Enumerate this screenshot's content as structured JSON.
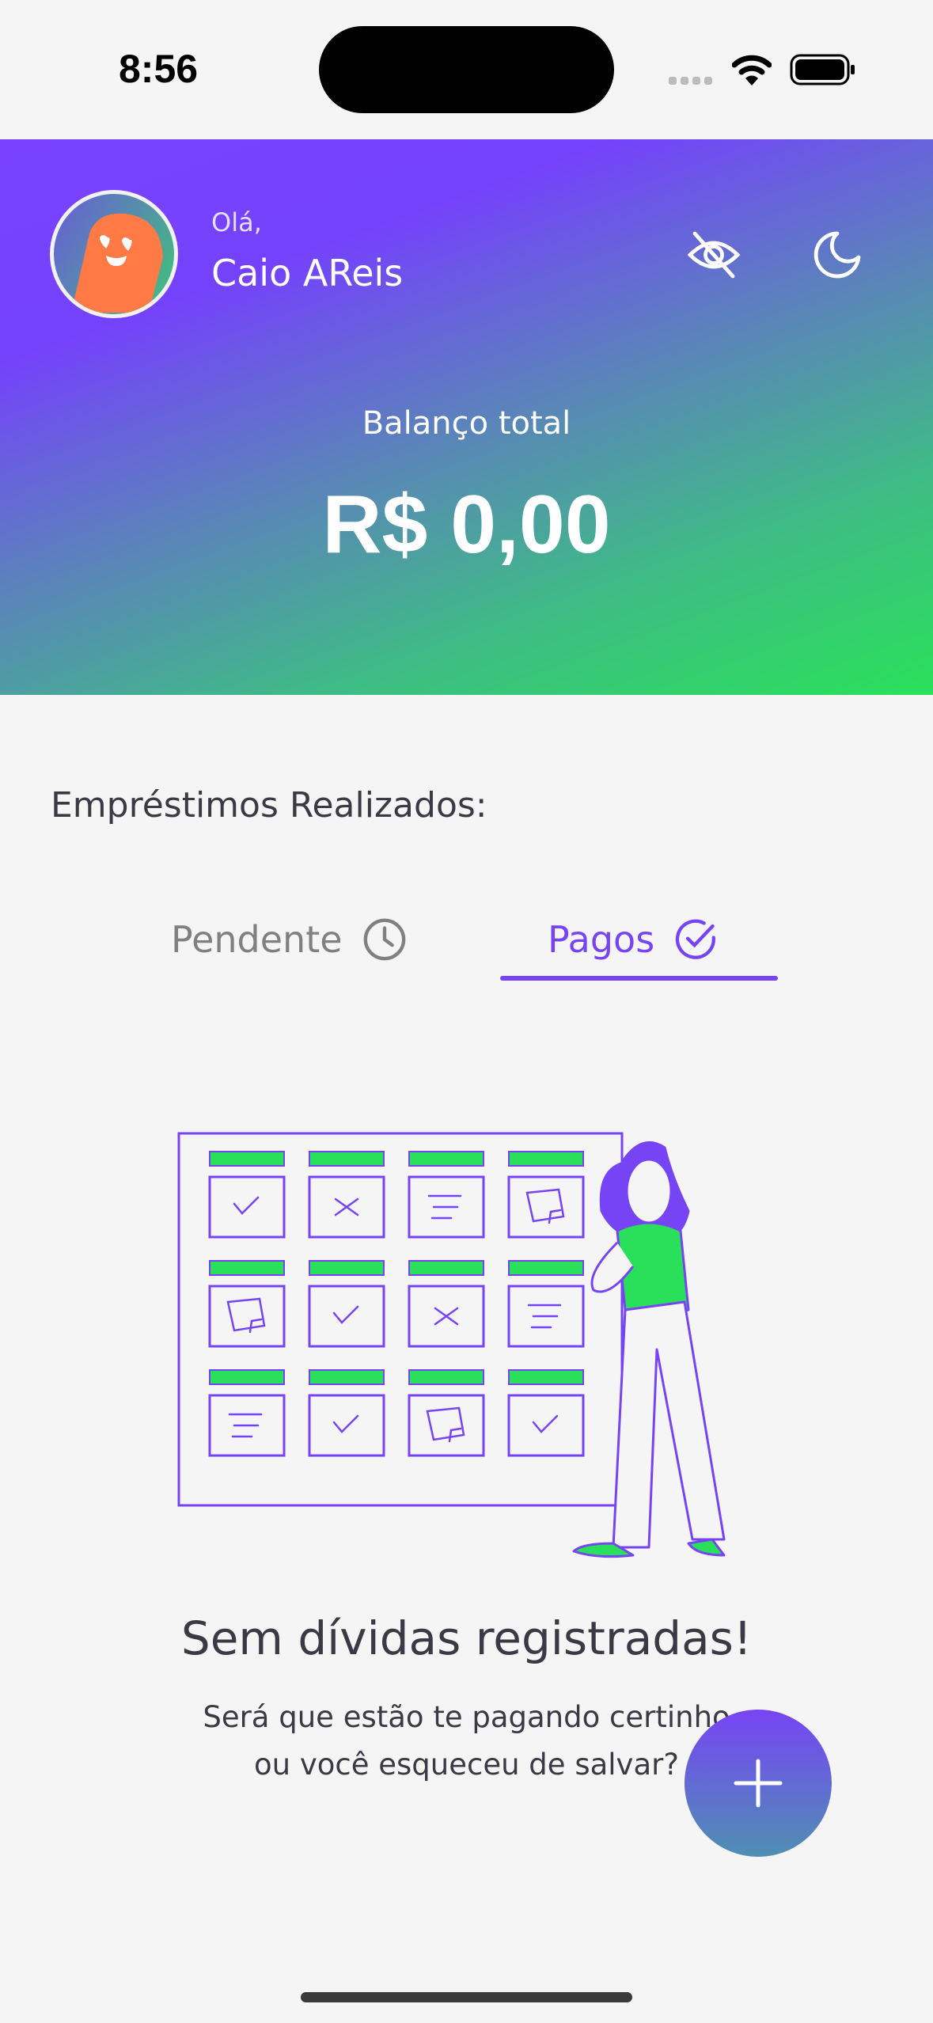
{
  "status_bar": {
    "time": "8:56",
    "icons": [
      "wifi-icon",
      "battery-icon"
    ]
  },
  "header": {
    "greeting": "Olá,",
    "user_name": "Caio AReis",
    "balance_label": "Balanço total",
    "balance_value": "R$ 0,00",
    "icons": [
      "eye-off-icon",
      "moon-icon"
    ]
  },
  "section": {
    "title": "Empréstimos Realizados:"
  },
  "tabs": [
    {
      "label": "Pendente",
      "icon": "clock-icon",
      "active": false
    },
    {
      "label": "Pagos",
      "icon": "check-circle-icon",
      "active": true
    }
  ],
  "empty_state": {
    "title": "Sem dívidas registradas!",
    "line1": "Será que estão te pagando certinho",
    "line2": "ou você esqueceu de salvar?"
  },
  "fab": {
    "icon": "plus-icon"
  },
  "colors": {
    "accent": "#7744f5",
    "green": "#2ae05a",
    "avatar_orange": "#ff7a45"
  }
}
